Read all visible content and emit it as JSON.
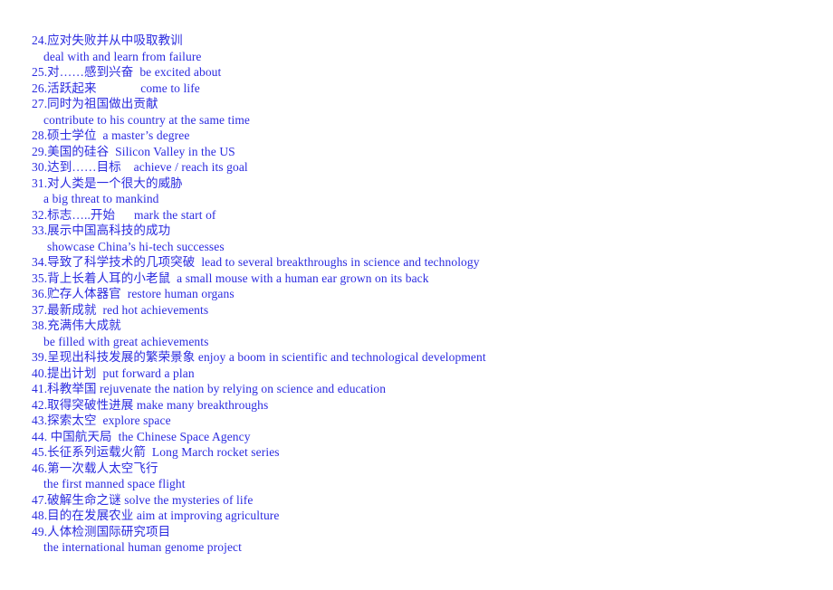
{
  "document": {
    "text_color": "#2b2be0",
    "background_color": "#ffffff",
    "lines": [
      {
        "text": "24.应对失败并从中吸取教训",
        "style": "entry"
      },
      {
        "text": "deal with and learn from failure",
        "style": "trans"
      },
      {
        "text": "25.对……感到兴奋  be excited about",
        "style": "entry"
      },
      {
        "text": "26.活跃起来              come to life",
        "style": "entry"
      },
      {
        "text": "27.同时为祖国做出贡献",
        "style": "entry"
      },
      {
        "text": "contribute to his country at the same time",
        "style": "trans"
      },
      {
        "text": "28.硕士学位  a master’s degree",
        "style": "entry"
      },
      {
        "text": "29.美国的硅谷  Silicon Valley in the US",
        "style": "entry"
      },
      {
        "text": "30.达到……目标    achieve / reach its goal",
        "style": "entry"
      },
      {
        "text": "31.对人类是一个很大的威胁",
        "style": "entry"
      },
      {
        "text": "a big threat to mankind",
        "style": "trans"
      },
      {
        "text": "32.标志…..开始      mark the start of",
        "style": "entry"
      },
      {
        "text": "33.展示中国高科技的成功",
        "style": "entry"
      },
      {
        "text": "showcase China’s hi-tech successes",
        "style": "trans-deep"
      },
      {
        "text": "34.导致了科学技术的几项突破  lead to several breakthroughs in science and technology",
        "style": "entry"
      },
      {
        "text": "35.背上长着人耳的小老鼠  a small mouse with a human ear grown on its back",
        "style": "entry"
      },
      {
        "text": "36.贮存人体器官  restore human organs",
        "style": "entry"
      },
      {
        "text": "37.最新成就  red hot achievements",
        "style": "entry"
      },
      {
        "text": "38.充满伟大成就",
        "style": "entry"
      },
      {
        "text": "be filled with great achievements",
        "style": "trans"
      },
      {
        "text": "39.呈现出科技发展的繁荣景象 enjoy a boom in scientific and technological development",
        "style": "entry"
      },
      {
        "text": "40.提出计划  put forward a plan",
        "style": "entry"
      },
      {
        "text": "41.科教举国 rejuvenate the nation by relying on science and education",
        "style": "entry"
      },
      {
        "text": "42.取得突破性进展 make many breakthroughs",
        "style": "entry"
      },
      {
        "text": "43.探索太空  explore space",
        "style": "entry"
      },
      {
        "text": "44. 中国航天局  the Chinese Space Agency",
        "style": "entry"
      },
      {
        "text": "45.长征系列运载火箭  Long March rocket series",
        "style": "entry"
      },
      {
        "text": "46.第一次载人太空飞行",
        "style": "entry"
      },
      {
        "text": "the first manned space flight",
        "style": "trans"
      },
      {
        "text": "47.破解生命之谜 solve the mysteries of life",
        "style": "entry"
      },
      {
        "text": "48.目的在发展农业 aim at improving agriculture",
        "style": "entry"
      },
      {
        "text": "49.人体检测国际研究项目",
        "style": "entry"
      },
      {
        "text": "the international human genome project",
        "style": "trans"
      }
    ]
  }
}
